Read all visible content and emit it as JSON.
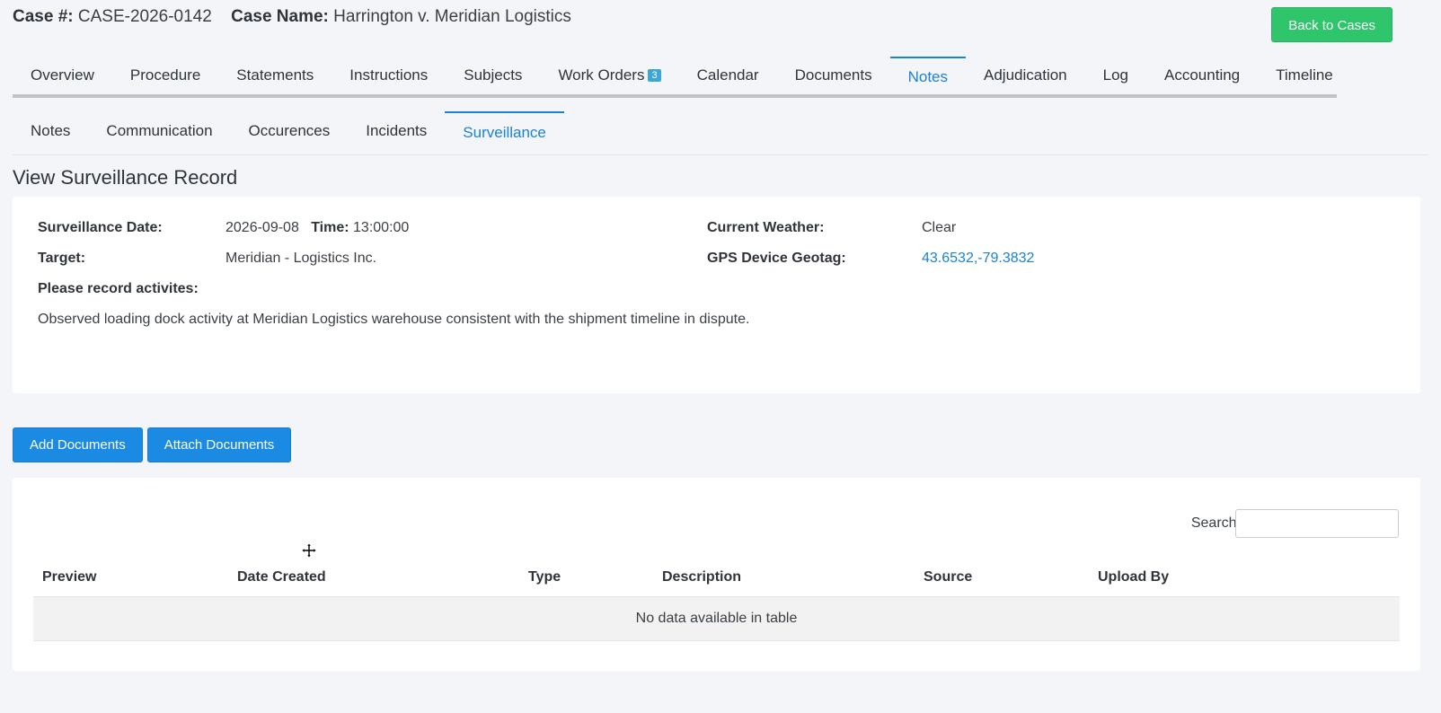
{
  "header": {
    "case_no_label": "Case #:",
    "case_no": "CASE-2026-0142",
    "case_name_label": "Case Name:",
    "case_name": "Harrington v. Meridian Logistics",
    "back_button": "Back to Cases"
  },
  "tabs": [
    {
      "label": "Overview"
    },
    {
      "label": "Procedure"
    },
    {
      "label": "Statements"
    },
    {
      "label": "Instructions"
    },
    {
      "label": "Subjects"
    },
    {
      "label": "Work Orders",
      "badge": "3"
    },
    {
      "label": "Calendar"
    },
    {
      "label": "Documents"
    },
    {
      "label": "Notes",
      "active": true
    },
    {
      "label": "Adjudication"
    },
    {
      "label": "Log"
    },
    {
      "label": "Accounting"
    },
    {
      "label": "Timeline"
    }
  ],
  "subtabs": [
    {
      "label": "Notes"
    },
    {
      "label": "Communication"
    },
    {
      "label": "Occurences"
    },
    {
      "label": "Incidents"
    },
    {
      "label": "Surveillance",
      "active": true
    }
  ],
  "record": {
    "title": "View Surveillance Record",
    "date_label": "Surveillance Date:",
    "date": "2026-09-08",
    "time_label": "Time:",
    "time": "13:00:00",
    "target_label": "Target:",
    "target": "Meridian - Logistics Inc.",
    "activities_label": "Please record activites:",
    "activities": "Observed loading dock activity at Meridian Logistics warehouse consistent with the shipment timeline in dispute.",
    "weather_label": "Current Weather:",
    "weather": "Clear",
    "gps_label": "GPS Device Geotag:",
    "gps": "43.6532,-79.3832"
  },
  "actions": {
    "add_documents": "Add Documents",
    "attach_documents": "Attach Documents"
  },
  "documents_table": {
    "search_label": "Search:",
    "columns": [
      "Preview",
      "Date Created",
      "Type",
      "Description",
      "Source",
      "Upload By"
    ],
    "empty_text": "No data available in table"
  },
  "colors": {
    "accent": "#1b82d6",
    "success": "#2ec56b",
    "primary_button": "#1b8ae3"
  }
}
